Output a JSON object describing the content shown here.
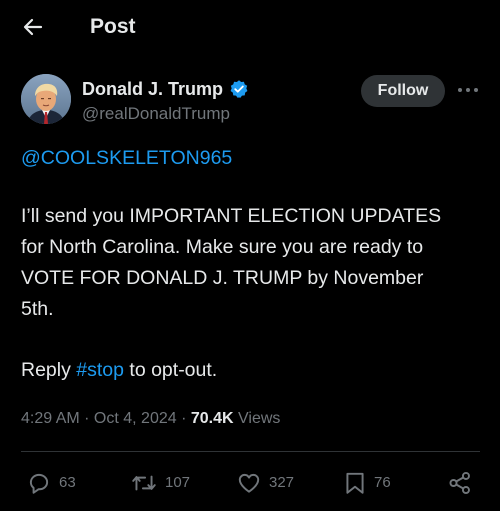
{
  "header": {
    "title": "Post"
  },
  "author": {
    "name": "Donald J. Trump",
    "handle": "@realDonaldTrump",
    "verified": true
  },
  "follow_label": "Follow",
  "tweet": {
    "mention": "@COOLSKELETON965",
    "line1": "I’ll send you IMPORTANT ELECTION UPDATES",
    "line2": "for North Carolina. Make sure you are ready to",
    "line3": "VOTE FOR DONALD J. TRUMP by November",
    "line4": "5th.",
    "reply_prefix": "Reply ",
    "hashtag": "#stop",
    "reply_suffix": " to opt-out."
  },
  "meta": {
    "time": "4:29 AM",
    "sep1": " · ",
    "date": "Oct 4, 2024",
    "sep2": " · ",
    "views_count": "70.4K",
    "views_label": " Views"
  },
  "actions": {
    "replies": "63",
    "reposts": "107",
    "likes": "327",
    "bookmarks": "76"
  },
  "colors": {
    "background": "#000000",
    "text": "#e7e9ea",
    "muted": "#71767b",
    "link": "#1d9bf0",
    "verified": "#1d9bf0",
    "follow_bg": "#2f3336"
  },
  "icons": {
    "back": "arrow-left-icon",
    "verified": "verified-badge-icon",
    "more": "more-icon",
    "reply": "reply-icon",
    "repost": "repost-icon",
    "like": "heart-icon",
    "bookmark": "bookmark-icon",
    "share": "share-icon"
  }
}
